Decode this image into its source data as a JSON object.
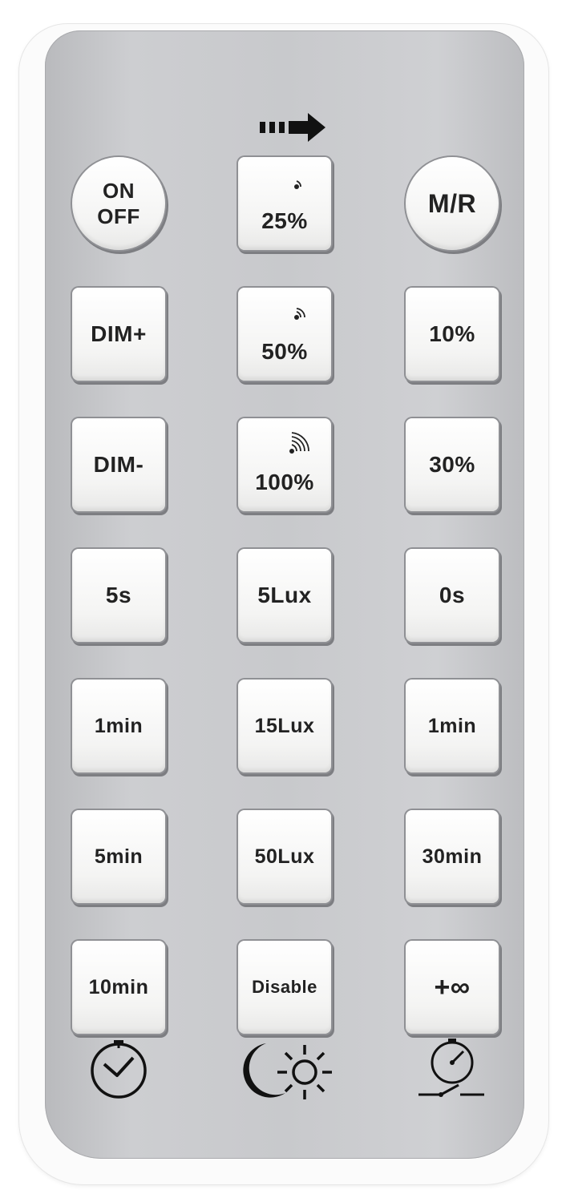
{
  "remote": {
    "row1": {
      "on_off_top": "ON",
      "on_off_bottom": "OFF",
      "pct25": "25%",
      "mr": "M/R"
    },
    "row2": {
      "dim_plus": "DIM+",
      "pct50": "50%",
      "pct10": "10%"
    },
    "row3": {
      "dim_minus": "DIM-",
      "pct100": "100%",
      "pct30": "30%"
    },
    "row4": {
      "t5s": "5s",
      "lux5": "5Lux",
      "t0s": "0s"
    },
    "row5": {
      "t1min_a": "1min",
      "lux15": "15Lux",
      "t1min_b": "1min"
    },
    "row6": {
      "t5min": "5min",
      "lux50": "50Lux",
      "t30min": "30min"
    },
    "row7": {
      "t10min": "10min",
      "disable": "Disable",
      "inf": "+∞"
    },
    "icons": [
      "send-arrow-icon",
      "signal-icon",
      "clock-icon",
      "moon-icon",
      "sun-icon",
      "gauge-switch-icon"
    ],
    "colors": {
      "panel": "#c8c9cc",
      "button": "#f6f6f5",
      "text": "#222222"
    }
  }
}
